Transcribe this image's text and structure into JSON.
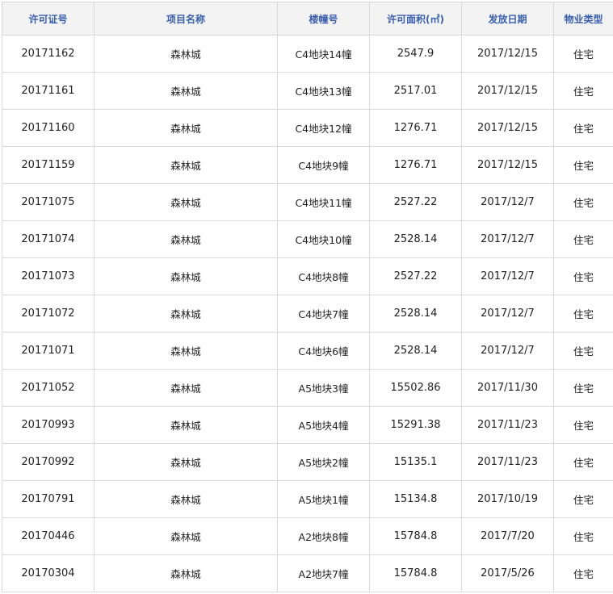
{
  "table": {
    "headers": [
      "许可证号",
      "项目名称",
      "楼幢号",
      "许可面积(㎡)",
      "发放日期",
      "物业类型"
    ],
    "rows": [
      [
        "20171162",
        "森林城",
        "C4地块14幢",
        "2547.9",
        "2017/12/15",
        "住宅"
      ],
      [
        "20171161",
        "森林城",
        "C4地块13幢",
        "2517.01",
        "2017/12/15",
        "住宅"
      ],
      [
        "20171160",
        "森林城",
        "C4地块12幢",
        "1276.71",
        "2017/12/15",
        "住宅"
      ],
      [
        "20171159",
        "森林城",
        "C4地块9幢",
        "1276.71",
        "2017/12/15",
        "住宅"
      ],
      [
        "20171075",
        "森林城",
        "C4地块11幢",
        "2527.22",
        "2017/12/7",
        "住宅"
      ],
      [
        "20171074",
        "森林城",
        "C4地块10幢",
        "2528.14",
        "2017/12/7",
        "住宅"
      ],
      [
        "20171073",
        "森林城",
        "C4地块8幢",
        "2527.22",
        "2017/12/7",
        "住宅"
      ],
      [
        "20171072",
        "森林城",
        "C4地块7幢",
        "2528.14",
        "2017/12/7",
        "住宅"
      ],
      [
        "20171071",
        "森林城",
        "C4地块6幢",
        "2528.14",
        "2017/12/7",
        "住宅"
      ],
      [
        "20171052",
        "森林城",
        "A5地块3幢",
        "15502.86",
        "2017/11/30",
        "住宅"
      ],
      [
        "20170993",
        "森林城",
        "A5地块4幢",
        "15291.38",
        "2017/11/23",
        "住宅"
      ],
      [
        "20170992",
        "森林城",
        "A5地块2幢",
        "15135.1",
        "2017/11/23",
        "住宅"
      ],
      [
        "20170791",
        "森林城",
        "A5地块1幢",
        "15134.8",
        "2017/10/19",
        "住宅"
      ],
      [
        "20170446",
        "森林城",
        "A2地块8幢",
        "15784.8",
        "2017/7/20",
        "住宅"
      ],
      [
        "20170304",
        "森林城",
        "A2地块7幢",
        "15784.8",
        "2017/5/26",
        "住宅"
      ]
    ]
  },
  "colors": {
    "header_text": "#3a5fae",
    "header_bg": "#f3f3f3",
    "border": "#d9d9d9",
    "cell_text": "#222222"
  }
}
